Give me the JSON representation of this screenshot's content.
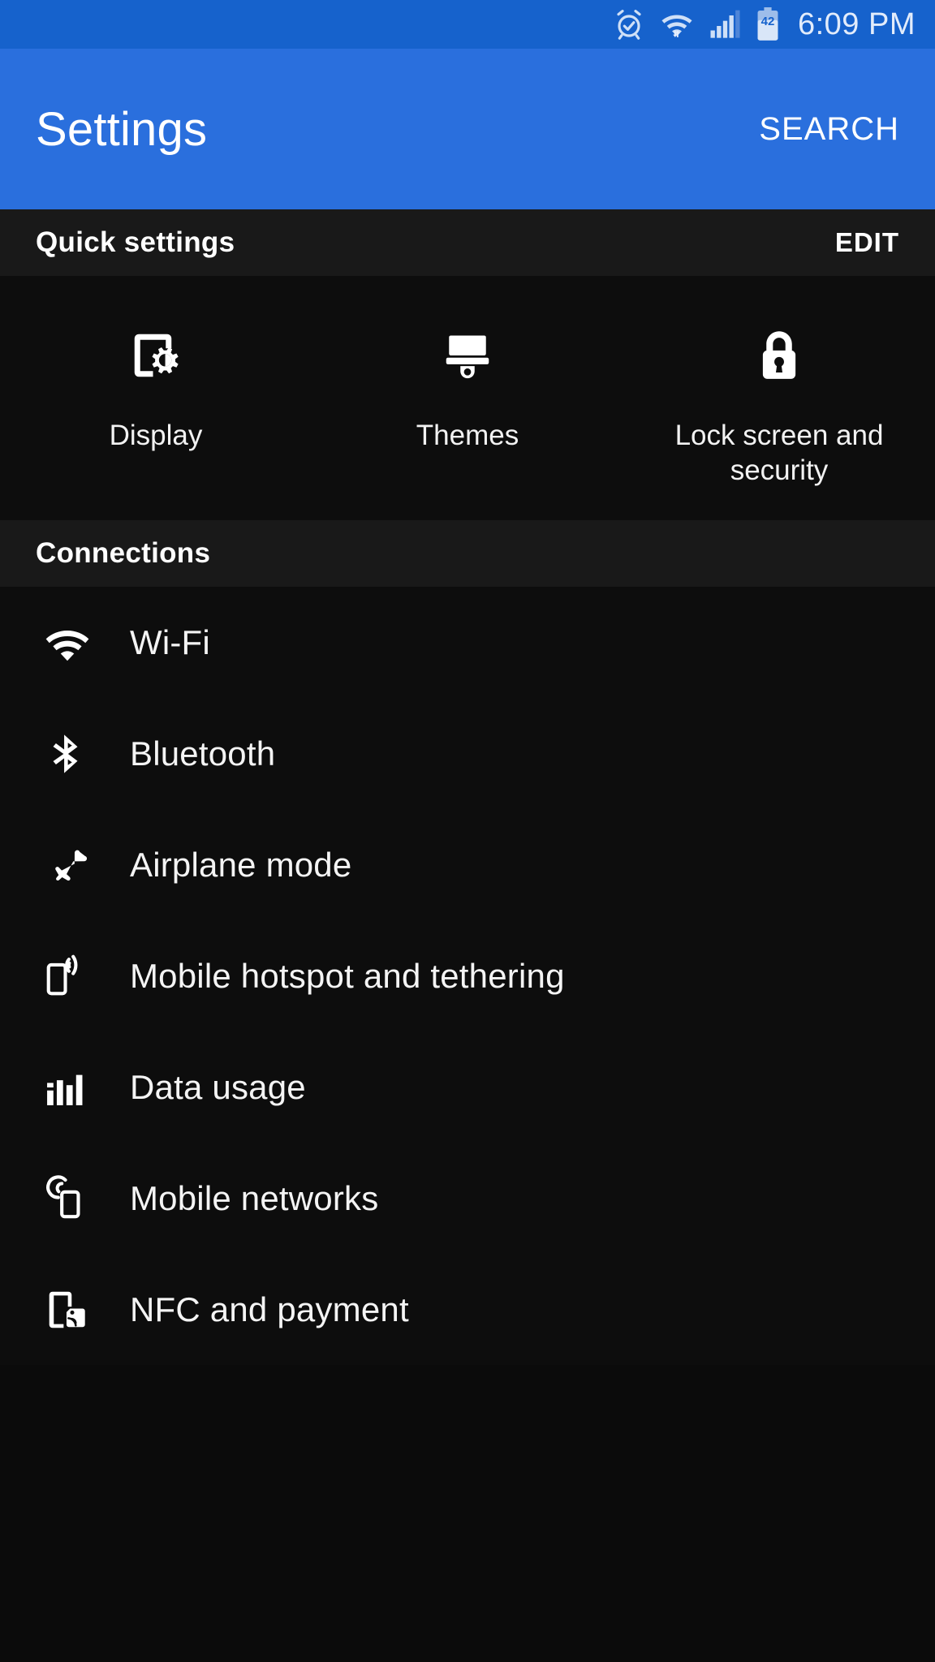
{
  "status_bar": {
    "icons": [
      "alarm-icon",
      "wifi-icon",
      "cellular-signal-icon",
      "battery-icon"
    ],
    "battery_level": "42",
    "time": "6:09 PM",
    "signal_bars_filled": 4,
    "signal_bars_total": 5
  },
  "app_bar": {
    "title": "Settings",
    "search_label": "SEARCH",
    "background_color": "#2a6fdd"
  },
  "quick_settings": {
    "header": "Quick settings",
    "edit_label": "EDIT",
    "items": [
      {
        "label": "Display",
        "icon": "display-settings-icon"
      },
      {
        "label": "Themes",
        "icon": "paintbrush-icon"
      },
      {
        "label": "Lock screen and security",
        "icon": "padlock-icon"
      }
    ]
  },
  "connections": {
    "header": "Connections",
    "items": [
      {
        "label": "Wi-Fi",
        "icon": "wifi-icon"
      },
      {
        "label": "Bluetooth",
        "icon": "bluetooth-icon"
      },
      {
        "label": "Airplane mode",
        "icon": "airplane-icon"
      },
      {
        "label": "Mobile hotspot and tethering",
        "icon": "hotspot-icon"
      },
      {
        "label": "Data usage",
        "icon": "bar-chart-icon"
      },
      {
        "label": "Mobile networks",
        "icon": "mobile-network-icon"
      },
      {
        "label": "NFC and payment",
        "icon": "nfc-icon"
      }
    ]
  },
  "colors": {
    "status_bar": "#1662cc",
    "app_bar": "#2a6fdd",
    "section_header_bg": "#191919",
    "content_bg": "#0d0d0d",
    "text_primary": "#f4f4f4"
  }
}
